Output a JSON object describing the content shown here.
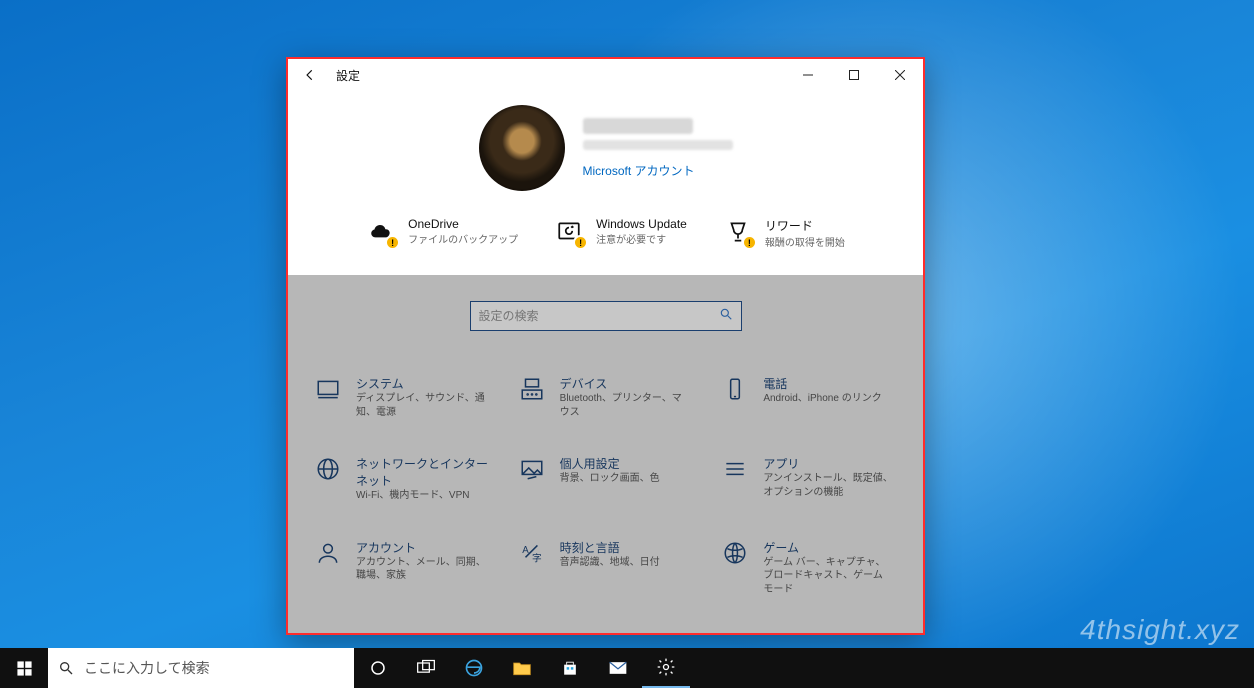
{
  "window": {
    "title": "設定",
    "account_link": "Microsoft アカウント"
  },
  "status": {
    "onedrive": {
      "title": "OneDrive",
      "desc": "ファイルのバックアップ"
    },
    "update": {
      "title": "Windows Update",
      "desc": "注意が必要です"
    },
    "rewards": {
      "title": "リワード",
      "desc": "報酬の取得を開始"
    }
  },
  "search": {
    "placeholder": "設定の検索"
  },
  "categories": {
    "system": {
      "title": "システム",
      "desc": "ディスプレイ、サウンド、通知、電源"
    },
    "devices": {
      "title": "デバイス",
      "desc": "Bluetooth、プリンター、マウス"
    },
    "phone": {
      "title": "電話",
      "desc": "Android、iPhone のリンク"
    },
    "network": {
      "title": "ネットワークとインターネット",
      "desc": "Wi-Fi、機内モード、VPN"
    },
    "personal": {
      "title": "個人用設定",
      "desc": "背景、ロック画面、色"
    },
    "apps": {
      "title": "アプリ",
      "desc": "アンインストール、既定値、オプションの機能"
    },
    "accounts": {
      "title": "アカウント",
      "desc": "アカウント、メール、同期、職場、家族"
    },
    "time": {
      "title": "時刻と言語",
      "desc": "音声認識、地域、日付"
    },
    "gaming": {
      "title": "ゲーム",
      "desc": "ゲーム バー、キャプチャ、ブロードキャスト、ゲーム モード"
    }
  },
  "taskbar": {
    "search_placeholder": "ここに入力して検索"
  },
  "watermark": "4thsight.xyz"
}
